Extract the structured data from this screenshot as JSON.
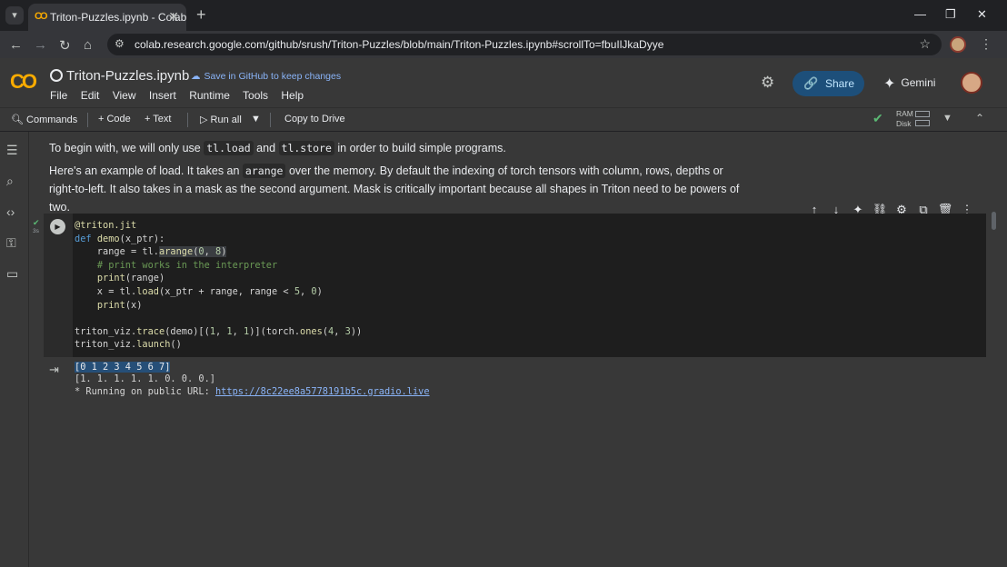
{
  "browser": {
    "tab_title": "Triton-Puzzles.ipynb - Colab",
    "url": "colab.research.google.com/github/srush/Triton-Puzzles/blob/main/Triton-Puzzles.ipynb#scrollTo=fbuIlJkaDyye"
  },
  "colab": {
    "logo": "CO",
    "notebook_title": "Triton-Puzzles.ipynb",
    "save_github": "Save in GitHub to keep changes",
    "menu": [
      "File",
      "Edit",
      "View",
      "Insert",
      "Runtime",
      "Tools",
      "Help"
    ],
    "share_label": "Share",
    "gemini_label": "Gemini"
  },
  "toolbar": {
    "commands": "Commands",
    "code": "+ Code",
    "text": "+ Text",
    "run_all": "Run all",
    "copy_drive": "Copy to Drive",
    "ram": "RAM",
    "disk": "Disk"
  },
  "text_cell": {
    "p1_a": "To begin with, we will only use ",
    "p1_code1": "tl.load",
    "p1_b": " and ",
    "p1_code2": "tl.store",
    "p1_c": " in order to build simple programs.",
    "p2_a": "Here's an example of load. It takes an ",
    "p2_code": "arange",
    "p2_b": " over the memory. By default the indexing of torch tensors with column, rows, depths or right-to-left. It also takes in a mask as the second argument. Mask is critically important because all shapes in Triton need to be powers of two."
  },
  "code_cell": {
    "exec_time": "3s"
  },
  "output": {
    "line1": "[0 1 2 3 4 5 6 7]",
    "line2": "[1. 1. 1. 1. 1. 0. 0. 0.]",
    "line3_prefix": "* Running on public URL: ",
    "line3_link": "https://8c22ee8a5778191b5c.gradio.live"
  },
  "colors": {
    "accent": "#f9ab00",
    "share_bg": "#1d4f7a",
    "link": "#8ab4f8"
  }
}
